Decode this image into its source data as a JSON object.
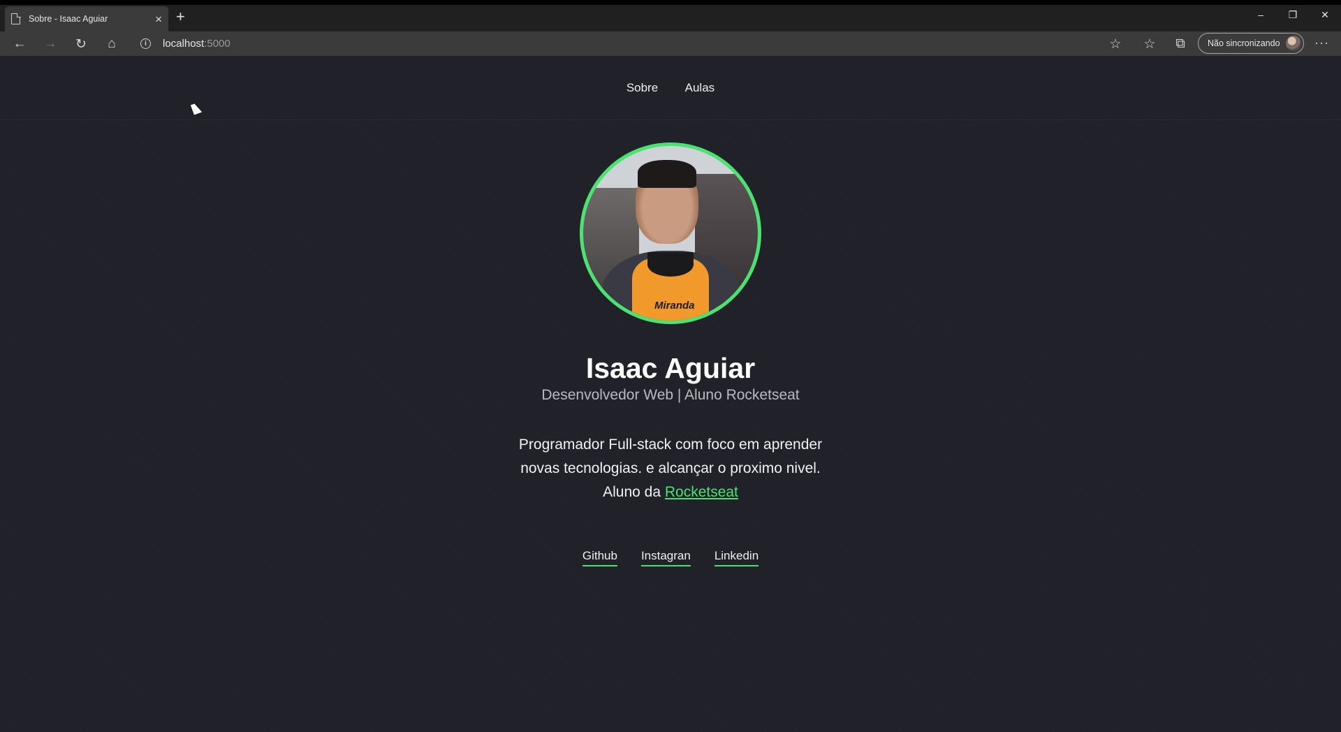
{
  "browser": {
    "tab": {
      "title": "Sobre - Isaac Aguiar",
      "close": "×"
    },
    "new_tab": "+",
    "window_controls": {
      "minimize": "–",
      "restore": "❐",
      "close": "✕"
    },
    "nav": {
      "back": "←",
      "forward": "→",
      "reload": "↻",
      "home": "⌂"
    },
    "address": {
      "host": "localhost",
      "port": ":5000"
    },
    "toolbar": {
      "favorite": "☆",
      "favorites_list": "☆",
      "collections": "⧉",
      "more": "···"
    },
    "sync_button": {
      "label": "Não sincronizando"
    }
  },
  "site": {
    "nav": [
      "Sobre",
      "Aulas"
    ],
    "profile": {
      "name": "Isaac Aguiar",
      "role": "Desenvolvedor Web | Aluno Rocketseat",
      "bio_line1": "Programador Full-stack com foco em aprender",
      "bio_line2": "novas tecnologias. e alcançar o proximo nivel.",
      "bio_line3_prefix": "Aluno da ",
      "bio_link": "Rocketseat",
      "photo_text": "Miranda"
    },
    "social": [
      "Github",
      "Instagran",
      "Linkedin"
    ],
    "colors": {
      "accent": "#49e36f",
      "background": "#1f2028"
    }
  }
}
